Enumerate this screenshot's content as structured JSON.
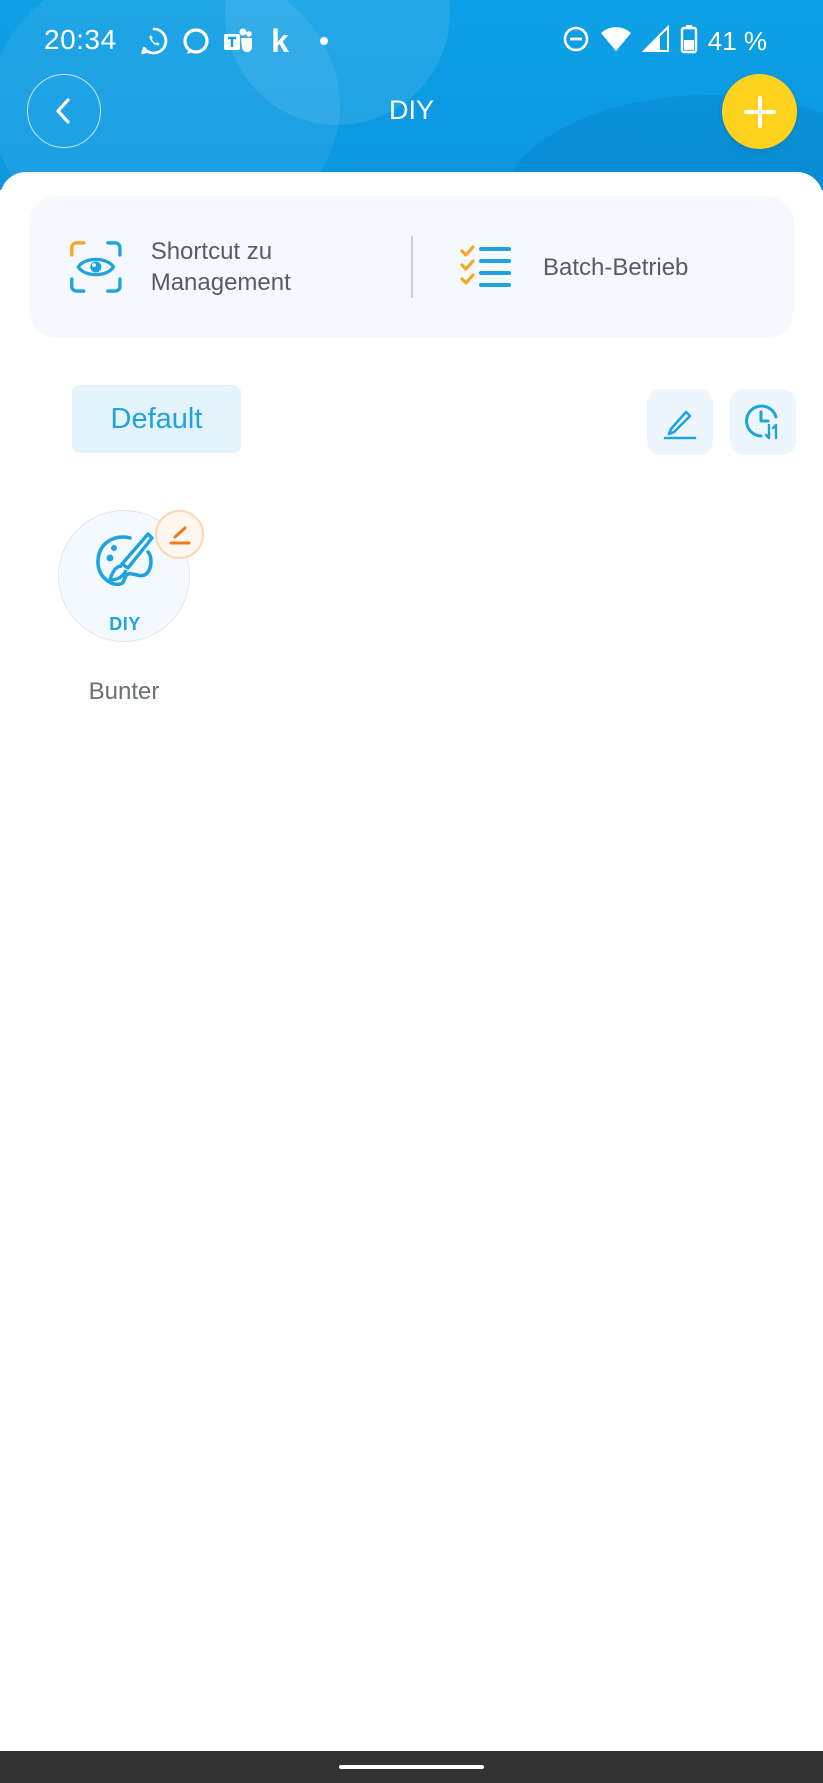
{
  "status_bar": {
    "time": "20:34",
    "notification_icons": [
      "whatsapp-icon",
      "alexa-icon",
      "teams-icon",
      "kleinanzeigen-icon",
      "notification-dot"
    ],
    "kleinanzeigen_glyph": "k",
    "system_icons": [
      "dnd-icon",
      "wifi-icon",
      "cell-signal-icon",
      "battery-icon"
    ],
    "battery_percent": "41 %"
  },
  "header": {
    "title": "DIY",
    "colors": {
      "primary": "#0ea0e6",
      "accent_add": "#ffd21f"
    }
  },
  "quick_actions": {
    "shortcut_label": "Shortcut zu Management",
    "batch_label": "Batch-Betrieb"
  },
  "groups": {
    "tabs": [
      {
        "label": "Default",
        "selected": true
      }
    ]
  },
  "scenes": [
    {
      "name": "Bunter",
      "badge": "DIY",
      "icon": "palette-brush-icon"
    }
  ]
}
